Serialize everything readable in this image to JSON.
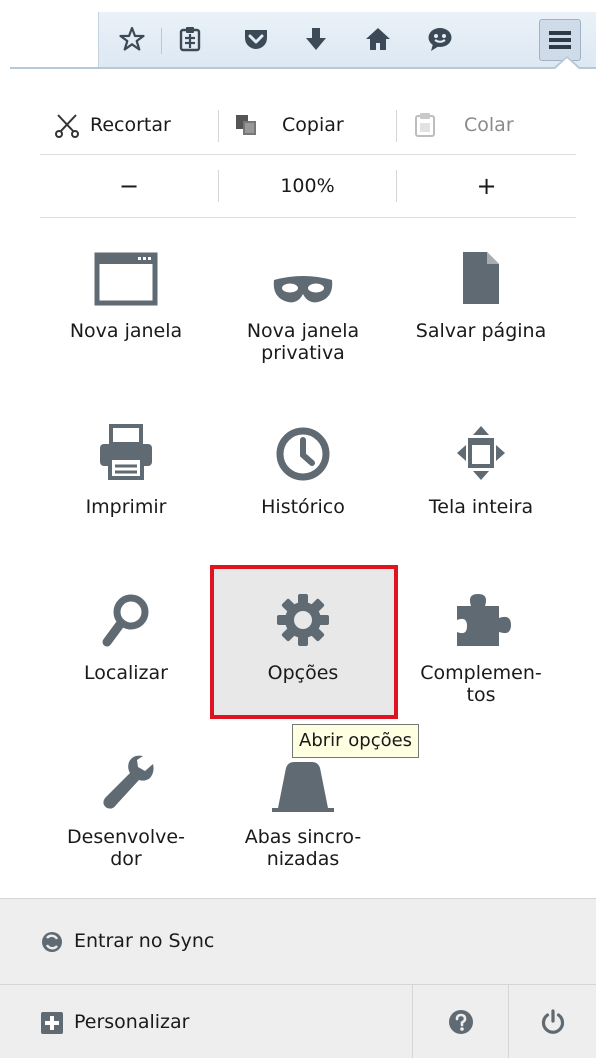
{
  "toolbar": {
    "icons": [
      "star-icon",
      "reading-list-icon",
      "pocket-icon",
      "download-icon",
      "home-icon",
      "chat-icon",
      "hamburger-menu-icon"
    ]
  },
  "edit": {
    "cut_label": "Recortar",
    "copy_label": "Copiar",
    "paste_label": "Colar"
  },
  "zoom": {
    "minus_label": "−",
    "level": "100%",
    "plus_label": "+"
  },
  "grid": {
    "new_window": "Nova janela",
    "private_window_line1": "Nova janela",
    "private_window_line2": "privativa",
    "save_page": "Salvar página",
    "print": "Imprimir",
    "history": "Histórico",
    "fullscreen": "Tela inteira",
    "find": "Localizar",
    "options": "Opções",
    "addons_line1": "Complemen-",
    "addons_line2": "tos",
    "developer_line1": "Desenvolve-",
    "developer_line2": "dor",
    "synced_tabs_line1": "Abas sincro-",
    "synced_tabs_line2": "nizadas"
  },
  "tooltip": "Abrir opções",
  "footer": {
    "sync_label": "Entrar no Sync",
    "customize_label": "Personalizar"
  },
  "colors": {
    "highlight_border": "#e0141e",
    "icon_gray": "#5f6a73",
    "toolbar_bg": "#e3ecf5"
  }
}
